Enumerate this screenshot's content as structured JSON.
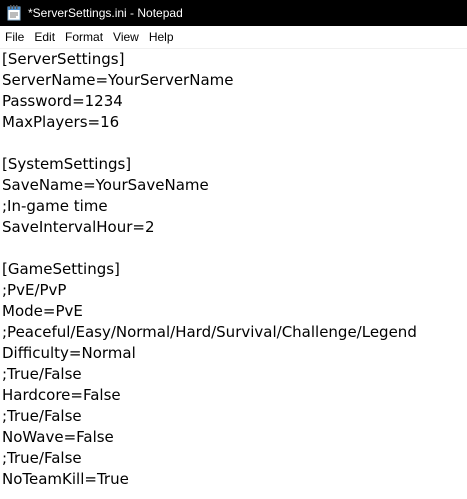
{
  "window": {
    "title": "*ServerSettings.ini - Notepad"
  },
  "menu": {
    "items": [
      "File",
      "Edit",
      "Format",
      "View",
      "Help"
    ]
  },
  "editor": {
    "lines": [
      "[ServerSettings]",
      "ServerName=YourServerName",
      "Password=1234",
      "MaxPlayers=16",
      "",
      "[SystemSettings]",
      "SaveName=YourSaveName",
      ";In-game time",
      "SaveIntervalHour=2",
      "",
      "[GameSettings]",
      ";PvE/PvP",
      "Mode=PvE",
      ";Peaceful/Easy/Normal/Hard/Survival/Challenge/Legend",
      "Difficulty=Normal",
      ";True/False",
      "Hardcore=False",
      ";True/False",
      "NoWave=False",
      ";True/False",
      "NoTeamKill=True"
    ]
  }
}
